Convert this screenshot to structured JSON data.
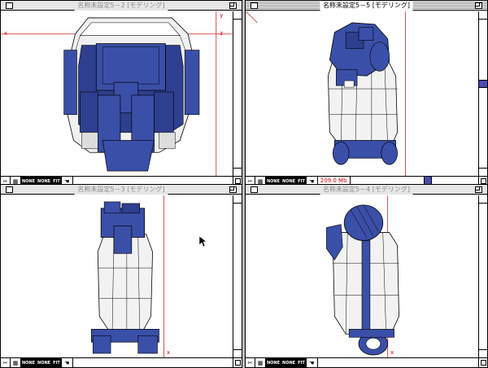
{
  "windows": {
    "top_left": {
      "title": "名称未設定5－2 [モデリング]",
      "active": false
    },
    "top_right": {
      "title": "名称未設定5－5 [モデリング]",
      "active": true,
      "status_text": "209.0 Mb"
    },
    "bottom_left": {
      "title": "名称未設定5－3 [モデリング]",
      "active": false
    },
    "bottom_right": {
      "title": "名称未設定5－4 [モデリング]",
      "active": false
    }
  },
  "toolbar": {
    "scissors": "✂",
    "hand": "☚",
    "mode_a": "NONE",
    "mode_b": "NONE",
    "fit": "FIT"
  },
  "axis_markers": {
    "x": "x",
    "y": "y",
    "z": "z"
  },
  "colors": {
    "accent_blue": "#3a4fa8",
    "guide_red": "#d02020",
    "status_red": "#d00000"
  },
  "icons": [
    "close-box",
    "zoom-box",
    "scissors-icon",
    "grid-icon",
    "hand-icon",
    "grow-box"
  ]
}
